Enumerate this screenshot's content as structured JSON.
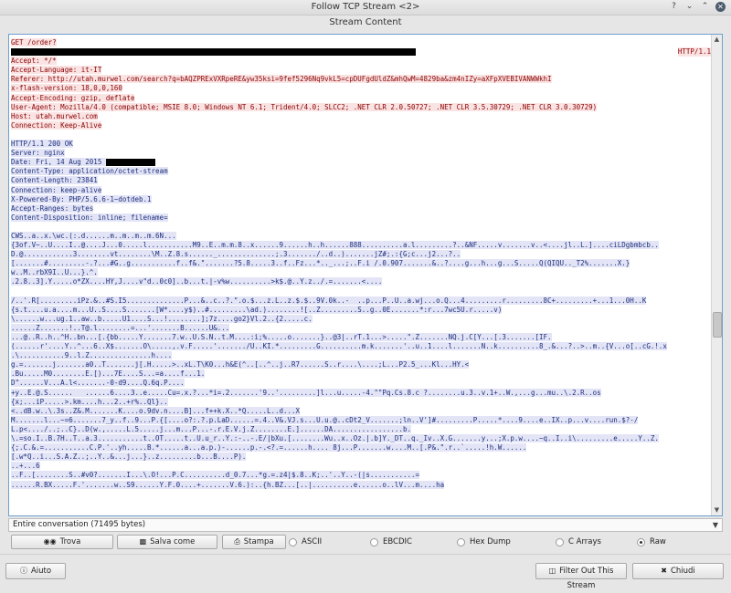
{
  "window": {
    "title": "Follow TCP Stream <2>"
  },
  "group_label": "Stream Content",
  "stream_lines": [
    {
      "kind": "client",
      "text": "GET /order?"
    },
    {
      "kind": "client",
      "text": "",
      "redact": [
        0,
        98
      ],
      "tail": "HTTP/1.1"
    },
    {
      "kind": "client",
      "text": "Accept: */*"
    },
    {
      "kind": "client",
      "text": "Accept-Language: it-IT"
    },
    {
      "kind": "client",
      "text": "Referer: http://utah.murwel.com/search?q=bAQZPRExVXRpeRE&yw35ksi=9fef5296Nq9vkL5=cpDUFgdUldZ&mhQwM=4829ba&zm4nIZy=aXFpXVEBIVANWWkhI"
    },
    {
      "kind": "client",
      "text": "x-flash-version: 18,0,0,160"
    },
    {
      "kind": "client",
      "text": "Accept-Encoding: gzip, deflate"
    },
    {
      "kind": "client",
      "text": "User-Agent: Mozilla/4.0 (compatible; MSIE 8.0; Windows NT 6.1; Trident/4.0; SLCC2; .NET CLR 2.0.50727; .NET CLR 3.5.30729; .NET CLR 3.0.30729)"
    },
    {
      "kind": "client",
      "text": "Host: utah.murwel.com"
    },
    {
      "kind": "client",
      "text": "Connection: Keep-Alive"
    },
    {
      "kind": "blank",
      "text": ""
    },
    {
      "kind": "server",
      "text": "HTTP/1.1 200 OK"
    },
    {
      "kind": "server",
      "text": "Server: nginx"
    },
    {
      "kind": "server",
      "text": "Date: Fri, 14 Aug 2015 ",
      "redact": [
        0,
        12
      ]
    },
    {
      "kind": "server",
      "text": "Content-Type: application/octet-stream"
    },
    {
      "kind": "server",
      "text": "Content-Length: 23841"
    },
    {
      "kind": "server",
      "text": "Connection: keep-alive"
    },
    {
      "kind": "server",
      "text": "X-Powered-By: PHP/5.6.6-1~dotdeb.1"
    },
    {
      "kind": "server",
      "text": "Accept-Ranges: bytes"
    },
    {
      "kind": "server",
      "text": "Content-Disposition: inline; filename="
    },
    {
      "kind": "blank",
      "text": ""
    },
    {
      "kind": "server",
      "text": "CWS..a..x.\\wc.(:.d......m..m..m..m.6N..."
    },
    {
      "kind": "server",
      "text": "{3of.V~..U....I..@....J...0.....l...........M9..E..m.m.8..x......9......h..h......888..........a.l.........?..&NF.....v.......v..<....jl..L.]....ciLDgbmbcb.."
    },
    {
      "kind": "server",
      "text": "D.@............3........vt........\\M..Z.8.s......_..............;.3......./..d..).......jZ#;.:{G;c...j2...?.."
    },
    {
      "kind": "server",
      "text": "[.......#.........-.?...#G..g...........f..f&.\".......?5.8.....3..f..Fz...*.._...;..F.i /.0.907.......&..?....g...h...g...S.....Q(QIQU.._T2%.......X.}"
    },
    {
      "kind": "server",
      "text": "w..M..rbX9I..U...}.^."
    },
    {
      "kind": "server",
      "text": ".2.8..3].Y.....o*ZX....HY,J....v\"d..0c0]..b...t.|-v%w..........>k$.@..Y.z../.=.......<...."
    },
    {
      "kind": "blank",
      "text": ""
    },
    {
      "kind": "server",
      "text": "/..'.R[.........iPz.&..#S.I5..............P...&..c..?.\".o.$...z.L..z.$.$..9V.0k..-  ..p...P..U..a.wj...o.Q...4.........r.........8C+.........+...1...0H..K"
    },
    {
      "kind": "server",
      "text": "{s.t....u.a....m...U..S....S.......[W*....y$)..#.........\\ad.)........![..Z.........S..g..0E.......*:r...7wc5U.r.....v)"
    },
    {
      "kind": "server",
      "text": "\\......w...ug.1..aw..b.....U1....S...!........];7z....go2}Vl.2..{2.....c."
    },
    {
      "kind": "server",
      "text": "......Z.......!..T@.l........=...'.......B......U&..."
    },
    {
      "kind": "server",
      "text": "...@..R..h..^H..bn...[.{bb.....Y.......7.w..U.S.N..t.M....:i;%.....o.......}..@3|..rT.1...>.....\".Z.......NQ.j.C[Y...[.3.......[IF."
    },
    {
      "kind": "server",
      "text": "(......r'....Y..^...6..X$.......O\\.....,.v.F.....'......./U..KI.*.........G..........m.k.......'..u..1....l.......N..k..........8_.&...?..>..m..{V...o[..cG.!.x"
    },
    {
      "kind": "server",
      "text": ".\\...........9..l.Z...............h...."
    },
    {
      "kind": "server",
      "text": "g.=.......j.......a0..T.......j[.H.....>..xL.T\\K0...h&E(^..[..^..j..R7......S..r....\\....;L...P2.5_...Kl...HY.<"
    },
    {
      "kind": "server",
      "text": ".Bu.....M0........E.[)...7E....S...=a....f...1."
    },
    {
      "kind": "server",
      "text": "D\"......V...A.l<.......-0-d9....Q.6q.P...."
    },
    {
      "kind": "server",
      "text": "+y..E.@.S......   ......6....3..e.....Cu=.x.?...*i=.2.......'9..'.........]l...u.....-4.\"\"Pq.Cs.8.c ?........u.3..v.1+..W.,...g...mu..\\.2.R..os"
    },
    {
      "kind": "server",
      "text": "{x;...iP.....>.km....h...2..+r%..Ql}.."
    },
    {
      "kind": "server",
      "text": "<..dB.w..\\.3s..Z&.M.......K....o.9dv.n....B]...f++k.X..*Q.....L..d...X"
    },
    {
      "kind": "server",
      "text": "M.......l...~=6.......7_y..f..9...P.{[....o?:.?.p.LaD......=.4..V&.VJ.s...U.u.@..cDt2_V.......;ln..V']#.........P.....*....9....e..IX..p...v....run.$?-/"
    },
    {
      "kind": "server",
      "text": "L.p<..../..;..C}..D(w.,.....L.5.....j...m...P...-.r.E.V.j.Z........E.]......DA.................b."
    },
    {
      "kind": "server",
      "text": "\\.=so.I..B.7H..T..a.3...........t..OT.....t..U.u_r..Y.:-..-.E/|bXu.[........Wu..x..Oz.|.b]Y._DT..q._Iv..X.G.......y...;X.p.w....~q..I..i\\.........e.....Y..Z."
    },
    {
      "kind": "server",
      "text": "{;.C.&.=...........C.P.'..yh.....B.*......a...a.p.)-......p.-.<?.=......h.... 8j...P.......w....M..[.P&.\".r..`.....!h.W......"
    },
    {
      "kind": "server",
      "text": "[.w*Q..i...S.A.Z..;..Y..&...j...}..z.........b...B....P)."
    },
    {
      "kind": "server",
      "text": "..+...6"
    },
    {
      "kind": "server",
      "text": "..F..[........S..#v0?.......I...\\.O!...P.C..........d_0.7...*g.=.z4|$.8..K;..'..Y..-(|s...........="
    },
    {
      "kind": "server",
      "text": "......R.BX.....F.'.......w..S9......Y.F.0....+.......V.6.):..{h.BZ...[..|..........e......o..lV...m....ha"
    }
  ],
  "conversation_select": {
    "value": "Entire conversation (71495 bytes)"
  },
  "actions": {
    "find": "Trova",
    "save_as": "Salva come",
    "print": "Stampa"
  },
  "formats": [
    {
      "label": "ASCII",
      "checked": false
    },
    {
      "label": "EBCDIC",
      "checked": false
    },
    {
      "label": "Hex Dump",
      "checked": false
    },
    {
      "label": "C Arrays",
      "checked": false
    },
    {
      "label": "Raw",
      "checked": true
    }
  ],
  "bottom": {
    "help": "Aiuto",
    "filter_out": "Filter Out This Stream",
    "close": "Chiudi"
  },
  "icons": {
    "find": "binoculars-icon",
    "save": "save-icon",
    "print": "printer-icon",
    "help": "help-icon",
    "filter": "filter-icon",
    "close": "close-icon"
  },
  "colors": {
    "client_text": "#8b0000",
    "client_bg": "#fae3e3",
    "server_text": "#1e2f7a",
    "server_bg": "#e3e5f7"
  }
}
